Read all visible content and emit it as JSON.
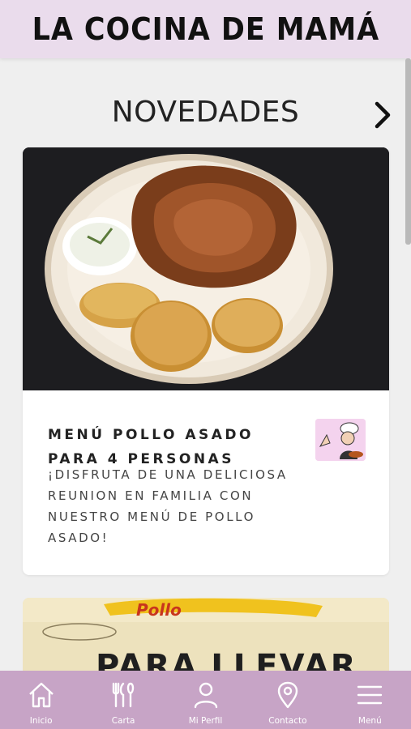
{
  "header": {
    "title": "LA COCINA DE MAMÁ"
  },
  "section": {
    "title": "NOVEDADES",
    "next_icon": "chevron-right-icon"
  },
  "card": {
    "title": "MENÚ POLLO ASADO PARA 4 PERSONAS",
    "description": "¡DISFRUTA DE UNA DELICIOSA REUNION EN FAMILIA CON NUESTRO MENÚ DE POLLO ASADO!",
    "image": "roast-chicken-with-potatoes-photo"
  },
  "card2": {
    "image": "takeaway-box-photo",
    "visible_text": "PARA LLEVAR"
  },
  "tabbar": {
    "items": [
      {
        "label": "Inicio",
        "icon": "home-icon"
      },
      {
        "label": "Carta",
        "icon": "utensils-icon"
      },
      {
        "label": "Mi Perfil",
        "icon": "user-icon"
      },
      {
        "label": "Contacto",
        "icon": "location-pin-icon"
      },
      {
        "label": "Menú",
        "icon": "hamburger-menu-icon"
      }
    ]
  },
  "colors": {
    "header_bg": "#eadcec",
    "tabbar_bg": "#c7a4c6",
    "page_bg": "#efefef"
  }
}
